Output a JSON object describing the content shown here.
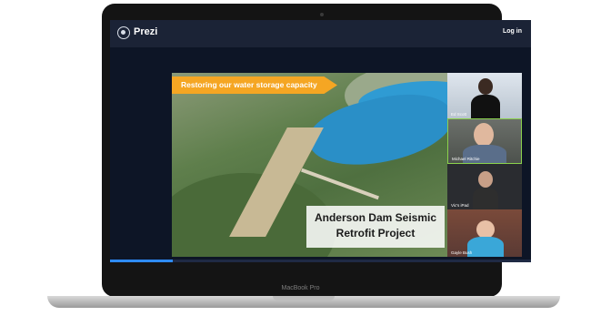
{
  "app": {
    "logo_text": "Prezi",
    "login_label": "Log in"
  },
  "slide": {
    "banner": "Restoring our water storage capacity",
    "caption_line1": "Anderson Dam Seismic",
    "caption_line2": "Retrofit Project"
  },
  "participants": [
    {
      "name": "Ed Scott"
    },
    {
      "name": "Michael Ritchie"
    },
    {
      "name": "Vic's iPad"
    },
    {
      "name": "Gayle Bush"
    }
  ],
  "device": {
    "model_label": "MacBook Pro"
  },
  "progress": {
    "fraction": 0.15
  }
}
